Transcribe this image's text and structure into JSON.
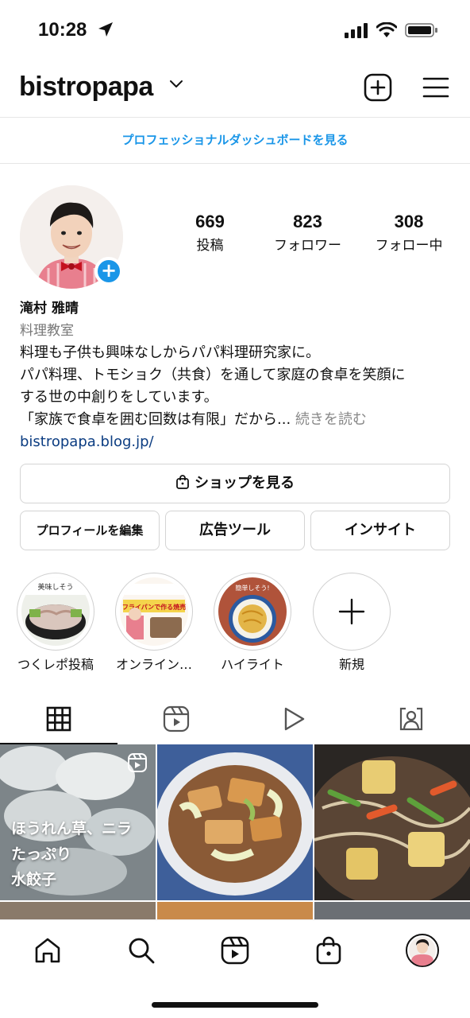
{
  "status_bar": {
    "time": "10:28"
  },
  "header": {
    "username": "bistropapa"
  },
  "dashboard": {
    "label": "プロフェッショナルダッシュボードを見る"
  },
  "stats": [
    {
      "value": "669",
      "label": "投稿"
    },
    {
      "value": "823",
      "label": "フォロワー"
    },
    {
      "value": "308",
      "label": "フォロー中"
    }
  ],
  "bio": {
    "name": "滝村 雅晴",
    "category": "料理教室",
    "line1": "料理も子供も興味なしからパパ料理研究家に。",
    "line2": "パパ料理、トモショク（共食）を通して家庭の食卓を笑顔に",
    "line3": "する世の中創りをしています。",
    "line4": "「家族で食卓を囲む回数は有限」だから...",
    "more": "続きを読む",
    "link": "bistropapa.blog.jp/"
  },
  "buttons": {
    "shop": "ショップを見る",
    "edit_profile": "プロフィールを編集",
    "ad_tools": "広告ツール",
    "insights": "インサイト"
  },
  "highlights": [
    {
      "label": "つくレポ投稿",
      "thumb_text": "美味しそう"
    },
    {
      "label": "オンライン…",
      "thumb_text": "フライパンで作る焼売"
    },
    {
      "label": "ハイライト",
      "thumb_text": "簡単しそう!"
    },
    {
      "label": "新規"
    }
  ],
  "grid": {
    "post1_text_l1": "ほうれん草、ニラ",
    "post1_text_l2": "たっぷり",
    "post1_text_l3": "水餃子"
  },
  "colors": {
    "accent_blue": "#1a96e8",
    "link_blue": "#0c3d82"
  }
}
